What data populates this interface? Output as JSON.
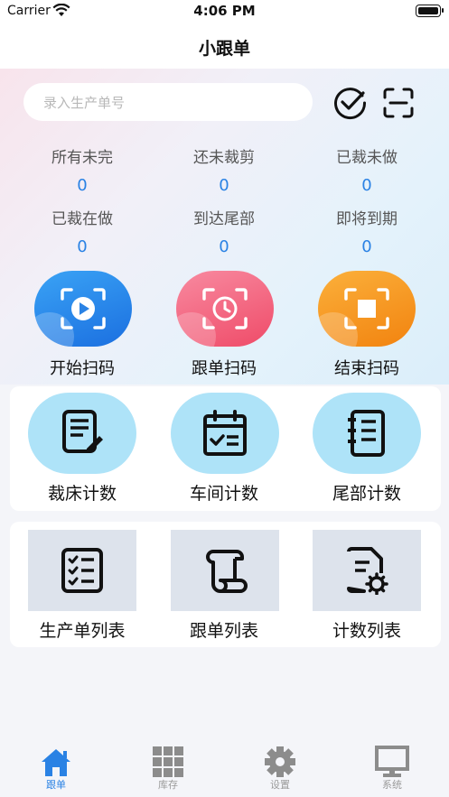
{
  "status_bar": {
    "carrier": "Carrier",
    "time": "4:06 PM"
  },
  "nav": {
    "title": "小跟单"
  },
  "search": {
    "placeholder": "录入生产单号"
  },
  "stats": [
    {
      "label": "所有未完",
      "value": "0"
    },
    {
      "label": "还未裁剪",
      "value": "0"
    },
    {
      "label": "已裁未做",
      "value": "0"
    },
    {
      "label": "已裁在做",
      "value": "0"
    },
    {
      "label": "到达尾部",
      "value": "0"
    },
    {
      "label": "即将到期",
      "value": "0"
    }
  ],
  "scan_buttons": [
    {
      "label": "开始扫码",
      "icon": "play-scan-icon",
      "color": "#2f8ff0"
    },
    {
      "label": "跟单扫码",
      "icon": "clock-scan-icon",
      "color": "#f4607a"
    },
    {
      "label": "结束扫码",
      "icon": "stop-scan-icon",
      "color": "#f7941d"
    }
  ],
  "count_cards": [
    {
      "label": "裁床计数",
      "icon": "document-edit-icon"
    },
    {
      "label": "车间计数",
      "icon": "calendar-check-icon"
    },
    {
      "label": "尾部计数",
      "icon": "notebook-icon"
    }
  ],
  "list_cards": [
    {
      "label": "生产单列表",
      "icon": "checklist-icon"
    },
    {
      "label": "跟单列表",
      "icon": "scroll-icon"
    },
    {
      "label": "计数列表",
      "icon": "document-gear-icon"
    }
  ],
  "tabs": [
    {
      "label": "跟单",
      "icon": "home-icon",
      "active": true
    },
    {
      "label": "库存",
      "icon": "grid-icon",
      "active": false
    },
    {
      "label": "设置",
      "icon": "gear-icon",
      "active": false
    },
    {
      "label": "系统",
      "icon": "monitor-icon",
      "active": false
    }
  ],
  "colors": {
    "accent": "#2a82e4",
    "card_icon_bg": "#aee3f8",
    "list_icon_bg": "#dde3ec"
  }
}
